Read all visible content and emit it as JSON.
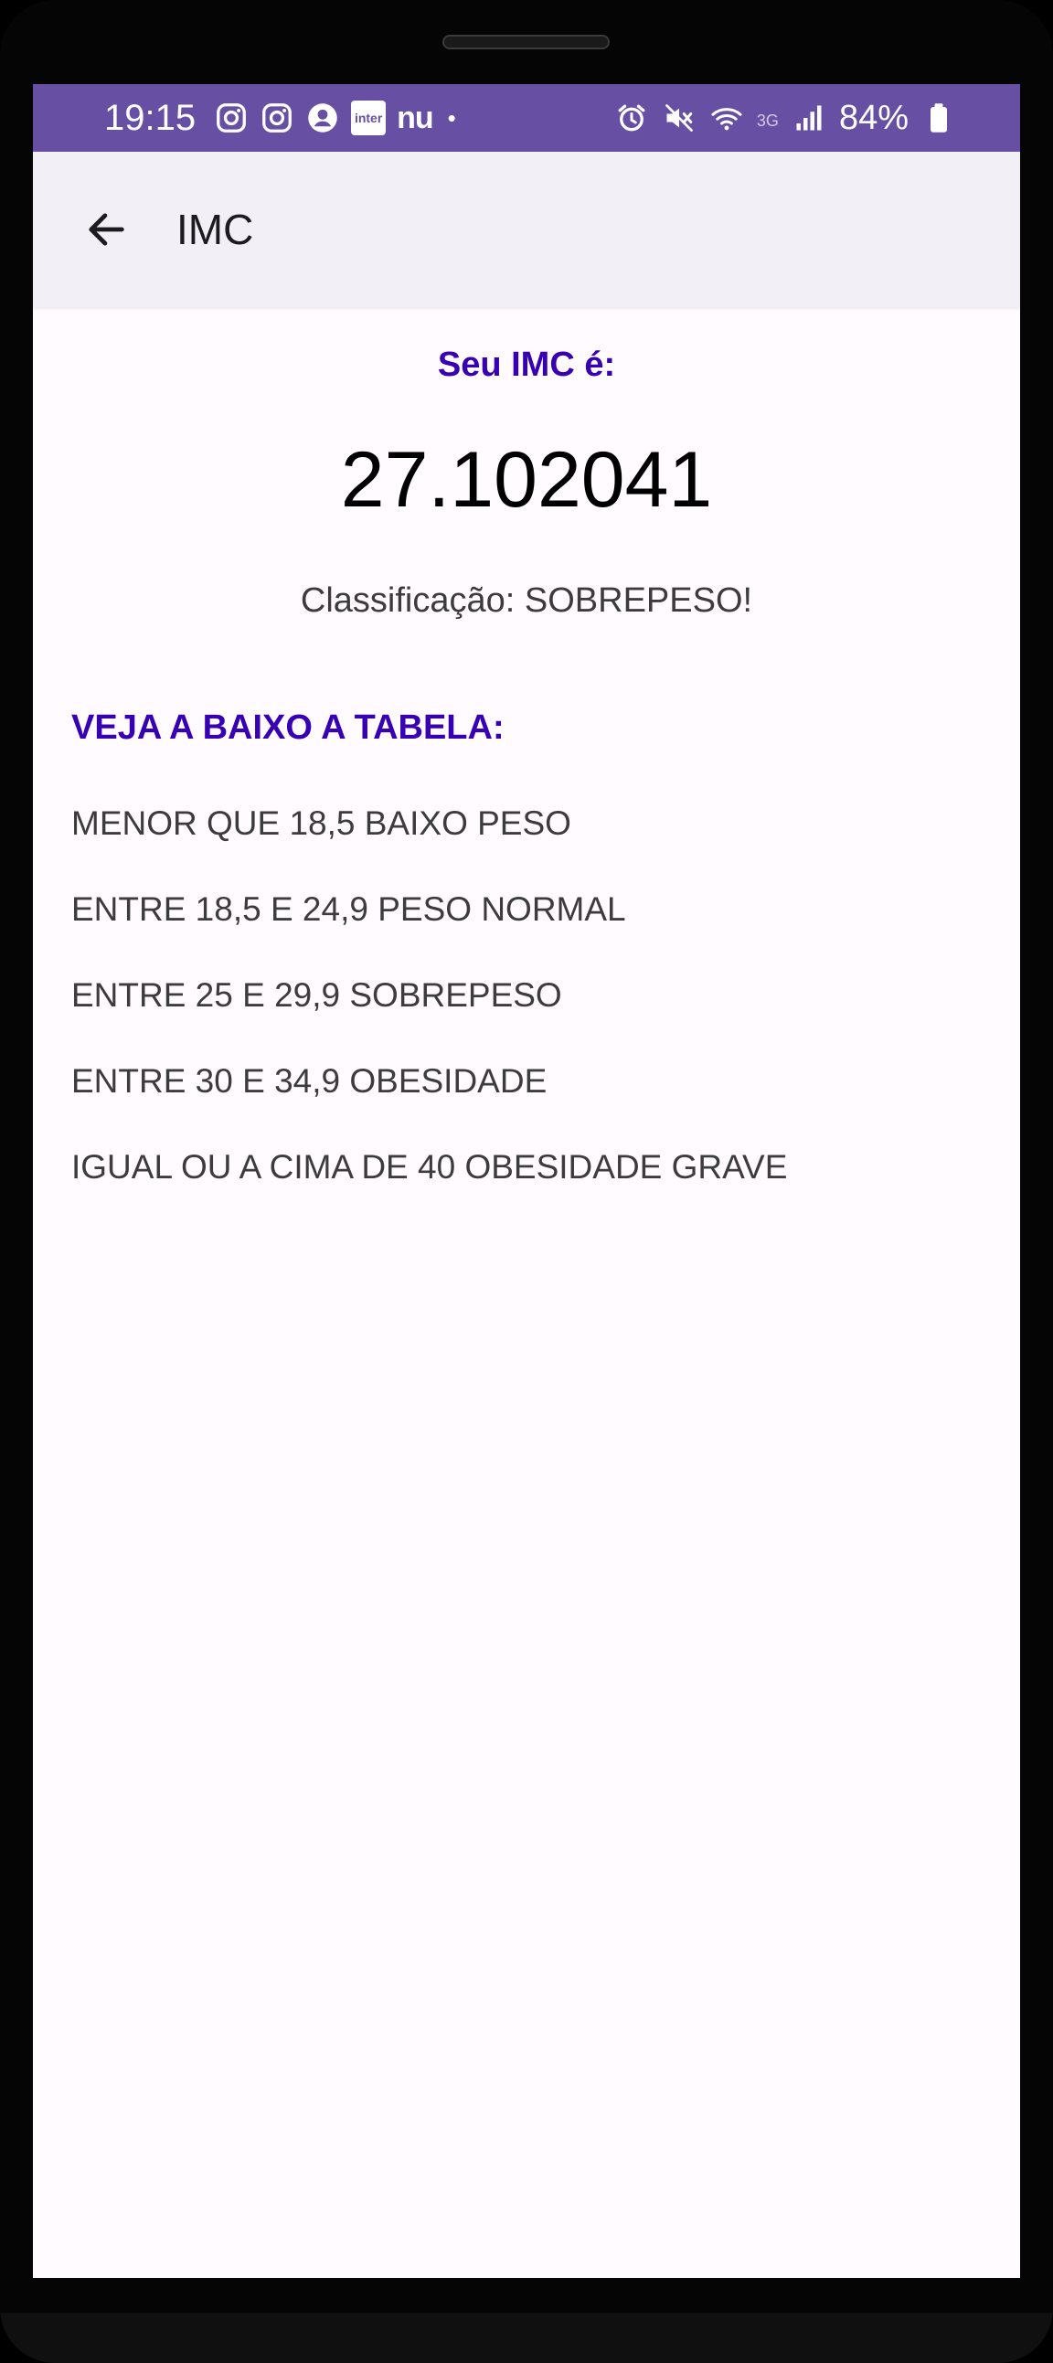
{
  "status_bar": {
    "time": "19:15",
    "notification_icons": [
      "instagram-icon",
      "instagram-icon",
      "account-icon",
      "inter-app-icon",
      "nubank-icon",
      "more-notifications-dot"
    ],
    "inter_label": "inter",
    "nu_label": "nu",
    "dot": "•",
    "system_icons": [
      "alarm-icon",
      "mute-icon",
      "wifi-icon",
      "signal-icon",
      "battery-icon"
    ],
    "network_type": "3G",
    "battery": "84%",
    "color": "#6750a4"
  },
  "app_bar": {
    "title": "IMC",
    "back_icon": "arrow-left-icon",
    "background": "#f3eff6"
  },
  "result": {
    "label": "Seu IMC é:",
    "value": "27.102041",
    "classification": "Classificação: SOBREPESO!"
  },
  "table": {
    "heading": "VEJA A BAIXO A TABELA:",
    "items": [
      "MENOR QUE 18,5 BAIXO PESO",
      "ENTRE 18,5 E 24,9 PESO NORMAL",
      "ENTRE 25 E 29,9 SOBREPESO",
      "ENTRE 30 E 34,9 OBESIDADE",
      "IGUAL OU A CIMA DE 40 OBESIDADE GRAVE"
    ]
  },
  "colors": {
    "accent": "#3700b3",
    "body_text": "#3c3c3c",
    "screen_background": "#fffbfe"
  }
}
